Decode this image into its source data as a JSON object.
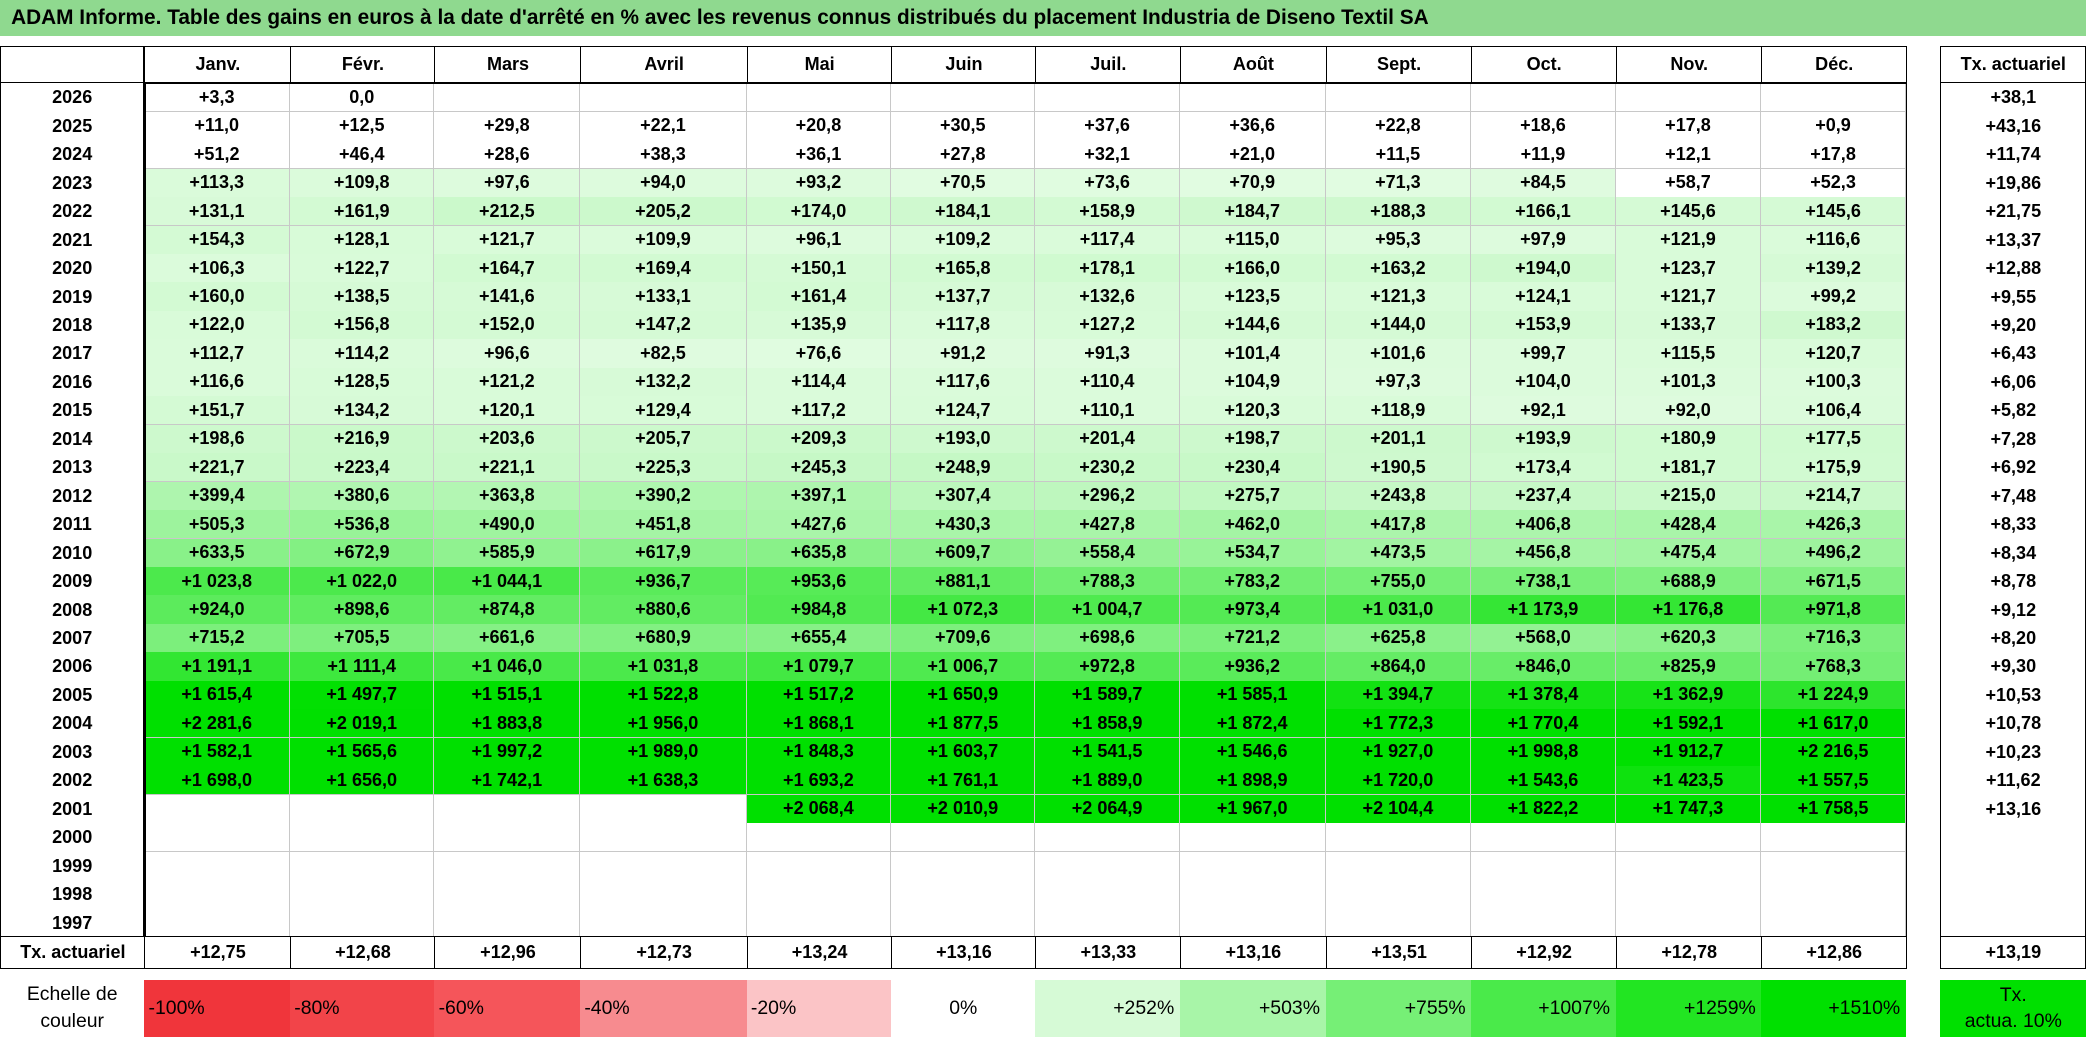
{
  "title": "ADAM Informe. Table des gains en euros à la date d'arrêté en % avec les revenus connus distribués du placement Industria de Diseno Textil SA",
  "months": [
    "Janv.",
    "Févr.",
    "Mars",
    "Avril",
    "Mai",
    "Juin",
    "Juil.",
    "Août",
    "Sept.",
    "Oct.",
    "Nov.",
    "Déc."
  ],
  "actuarial_header": "Tx. actuariel",
  "rows": [
    {
      "year": "2026",
      "values": [
        "+3,3",
        "0,0",
        "",
        "",
        "",
        "",
        "",
        "",
        "",
        "",
        "",
        ""
      ],
      "rate": "+38,1"
    },
    {
      "year": "2025",
      "values": [
        "+11,0",
        "+12,5",
        "+29,8",
        "+22,1",
        "+20,8",
        "+30,5",
        "+37,6",
        "+36,6",
        "+22,8",
        "+18,6",
        "+17,8",
        "+0,9"
      ],
      "rate": "+43,16"
    },
    {
      "year": "2024",
      "values": [
        "+51,2",
        "+46,4",
        "+28,6",
        "+38,3",
        "+36,1",
        "+27,8",
        "+32,1",
        "+21,0",
        "+11,5",
        "+11,9",
        "+12,1",
        "+17,8"
      ],
      "rate": "+11,74"
    },
    {
      "year": "2023",
      "values": [
        "+113,3",
        "+109,8",
        "+97,6",
        "+94,0",
        "+93,2",
        "+70,5",
        "+73,6",
        "+70,9",
        "+71,3",
        "+84,5",
        "+58,7",
        "+52,3"
      ],
      "rate": "+19,86"
    },
    {
      "year": "2022",
      "values": [
        "+131,1",
        "+161,9",
        "+212,5",
        "+205,2",
        "+174,0",
        "+184,1",
        "+158,9",
        "+184,7",
        "+188,3",
        "+166,1",
        "+145,6",
        "+145,6"
      ],
      "rate": "+21,75"
    },
    {
      "year": "2021",
      "values": [
        "+154,3",
        "+128,1",
        "+121,7",
        "+109,9",
        "+96,1",
        "+109,2",
        "+117,4",
        "+115,0",
        "+95,3",
        "+97,9",
        "+121,9",
        "+116,6"
      ],
      "rate": "+13,37"
    },
    {
      "year": "2020",
      "values": [
        "+106,3",
        "+122,7",
        "+164,7",
        "+169,4",
        "+150,1",
        "+165,8",
        "+178,1",
        "+166,0",
        "+163,2",
        "+194,0",
        "+123,7",
        "+139,2"
      ],
      "rate": "+12,88"
    },
    {
      "year": "2019",
      "values": [
        "+160,0",
        "+138,5",
        "+141,6",
        "+133,1",
        "+161,4",
        "+137,7",
        "+132,6",
        "+123,5",
        "+121,3",
        "+124,1",
        "+121,7",
        "+99,2"
      ],
      "rate": "+9,55"
    },
    {
      "year": "2018",
      "values": [
        "+122,0",
        "+156,8",
        "+152,0",
        "+147,2",
        "+135,9",
        "+117,8",
        "+127,2",
        "+144,6",
        "+144,0",
        "+153,9",
        "+133,7",
        "+183,2"
      ],
      "rate": "+9,20"
    },
    {
      "year": "2017",
      "values": [
        "+112,7",
        "+114,2",
        "+96,6",
        "+82,5",
        "+76,6",
        "+91,2",
        "+91,3",
        "+101,4",
        "+101,6",
        "+99,7",
        "+115,5",
        "+120,7"
      ],
      "rate": "+6,43"
    },
    {
      "year": "2016",
      "values": [
        "+116,6",
        "+128,5",
        "+121,2",
        "+132,2",
        "+114,4",
        "+117,6",
        "+110,4",
        "+104,9",
        "+97,3",
        "+104,0",
        "+101,3",
        "+100,3"
      ],
      "rate": "+6,06"
    },
    {
      "year": "2015",
      "values": [
        "+151,7",
        "+134,2",
        "+120,1",
        "+129,4",
        "+117,2",
        "+124,7",
        "+110,1",
        "+120,3",
        "+118,9",
        "+92,1",
        "+92,0",
        "+106,4"
      ],
      "rate": "+5,82"
    },
    {
      "year": "2014",
      "values": [
        "+198,6",
        "+216,9",
        "+203,6",
        "+205,7",
        "+209,3",
        "+193,0",
        "+201,4",
        "+198,7",
        "+201,1",
        "+193,9",
        "+180,9",
        "+177,5"
      ],
      "rate": "+7,28"
    },
    {
      "year": "2013",
      "values": [
        "+221,7",
        "+223,4",
        "+221,1",
        "+225,3",
        "+245,3",
        "+248,9",
        "+230,2",
        "+230,4",
        "+190,5",
        "+173,4",
        "+181,7",
        "+175,9"
      ],
      "rate": "+6,92"
    },
    {
      "year": "2012",
      "values": [
        "+399,4",
        "+380,6",
        "+363,8",
        "+390,2",
        "+397,1",
        "+307,4",
        "+296,2",
        "+275,7",
        "+243,8",
        "+237,4",
        "+215,0",
        "+214,7"
      ],
      "rate": "+7,48"
    },
    {
      "year": "2011",
      "values": [
        "+505,3",
        "+536,8",
        "+490,0",
        "+451,8",
        "+427,6",
        "+430,3",
        "+427,8",
        "+462,0",
        "+417,8",
        "+406,8",
        "+428,4",
        "+426,3"
      ],
      "rate": "+8,33"
    },
    {
      "year": "2010",
      "values": [
        "+633,5",
        "+672,9",
        "+585,9",
        "+617,9",
        "+635,8",
        "+609,7",
        "+558,4",
        "+534,7",
        "+473,5",
        "+456,8",
        "+475,4",
        "+496,2"
      ],
      "rate": "+8,34"
    },
    {
      "year": "2009",
      "values": [
        "+1 023,8",
        "+1 022,0",
        "+1 044,1",
        "+936,7",
        "+953,6",
        "+881,1",
        "+788,3",
        "+783,2",
        "+755,0",
        "+738,1",
        "+688,9",
        "+671,5"
      ],
      "rate": "+8,78"
    },
    {
      "year": "2008",
      "values": [
        "+924,0",
        "+898,6",
        "+874,8",
        "+880,6",
        "+984,8",
        "+1 072,3",
        "+1 004,7",
        "+973,4",
        "+1 031,0",
        "+1 173,9",
        "+1 176,8",
        "+971,8"
      ],
      "rate": "+9,12"
    },
    {
      "year": "2007",
      "values": [
        "+715,2",
        "+705,5",
        "+661,6",
        "+680,9",
        "+655,4",
        "+709,6",
        "+698,6",
        "+721,2",
        "+625,8",
        "+568,0",
        "+620,3",
        "+716,3"
      ],
      "rate": "+8,20"
    },
    {
      "year": "2006",
      "values": [
        "+1 191,1",
        "+1 111,4",
        "+1 046,0",
        "+1 031,8",
        "+1 079,7",
        "+1 006,7",
        "+972,8",
        "+936,2",
        "+864,0",
        "+846,0",
        "+825,9",
        "+768,3"
      ],
      "rate": "+9,30"
    },
    {
      "year": "2005",
      "values": [
        "+1 615,4",
        "+1 497,7",
        "+1 515,1",
        "+1 522,8",
        "+1 517,2",
        "+1 650,9",
        "+1 589,7",
        "+1 585,1",
        "+1 394,7",
        "+1 378,4",
        "+1 362,9",
        "+1 224,9"
      ],
      "rate": "+10,53"
    },
    {
      "year": "2004",
      "values": [
        "+2 281,6",
        "+2 019,1",
        "+1 883,8",
        "+1 956,0",
        "+1 868,1",
        "+1 877,5",
        "+1 858,9",
        "+1 872,4",
        "+1 772,3",
        "+1 770,4",
        "+1 592,1",
        "+1 617,0"
      ],
      "rate": "+10,78"
    },
    {
      "year": "2003",
      "values": [
        "+1 582,1",
        "+1 565,6",
        "+1 997,2",
        "+1 989,0",
        "+1 848,3",
        "+1 603,7",
        "+1 541,5",
        "+1 546,6",
        "+1 927,0",
        "+1 998,8",
        "+1 912,7",
        "+2 216,5"
      ],
      "rate": "+10,23"
    },
    {
      "year": "2002",
      "values": [
        "+1 698,0",
        "+1 656,0",
        "+1 742,1",
        "+1 638,3",
        "+1 693,2",
        "+1 761,1",
        "+1 889,0",
        "+1 898,9",
        "+1 720,0",
        "+1 543,6",
        "+1 423,5",
        "+1 557,5"
      ],
      "rate": "+11,62"
    },
    {
      "year": "2001",
      "values": [
        "",
        "",
        "",
        "",
        "+2 068,4",
        "+2 010,9",
        "+2 064,9",
        "+1 967,0",
        "+2 104,4",
        "+1 822,2",
        "+1 747,3",
        "+1 758,5"
      ],
      "rate": "+13,16"
    },
    {
      "year": "2000",
      "values": [
        "",
        "",
        "",
        "",
        "",
        "",
        "",
        "",
        "",
        "",
        "",
        ""
      ],
      "rate": ""
    },
    {
      "year": "1999",
      "values": [
        "",
        "",
        "",
        "",
        "",
        "",
        "",
        "",
        "",
        "",
        "",
        ""
      ],
      "rate": ""
    },
    {
      "year": "1998",
      "values": [
        "",
        "",
        "",
        "",
        "",
        "",
        "",
        "",
        "",
        "",
        "",
        ""
      ],
      "rate": ""
    },
    {
      "year": "1997",
      "values": [
        "",
        "",
        "",
        "",
        "",
        "",
        "",
        "",
        "",
        "",
        "",
        ""
      ],
      "rate": ""
    }
  ],
  "footer": {
    "label": "Tx. actuariel",
    "values": [
      "+12,75",
      "+12,68",
      "+12,96",
      "+12,73",
      "+13,24",
      "+13,16",
      "+13,33",
      "+13,16",
      "+13,51",
      "+12,92",
      "+12,78",
      "+12,86"
    ],
    "total": "+13,19"
  },
  "legend": {
    "label_line1": "Echelle de",
    "label_line2": "couleur",
    "items": [
      {
        "text": "-100%",
        "color": "#f0353b"
      },
      {
        "text": "-80%",
        "color": "#f24449"
      },
      {
        "text": "-60%",
        "color": "#f5555a"
      },
      {
        "text": "-40%",
        "color": "#f78b8f"
      },
      {
        "text": "-20%",
        "color": "#fbc4c6"
      },
      {
        "text": "0%",
        "color": "#ffffff"
      },
      {
        "text": "+252%",
        "color": "#d6fad6"
      },
      {
        "text": "+503%",
        "color": "#a8f5a8"
      },
      {
        "text": "+755%",
        "color": "#76ef76"
      },
      {
        "text": "+1007%",
        "color": "#4aea4a"
      },
      {
        "text": "+1259%",
        "color": "#22e522"
      },
      {
        "text": "+1510%",
        "color": "#00e000"
      }
    ],
    "actuarial_line1": "Tx.",
    "actuarial_line2": "actua. 10%",
    "actuarial_color": "#00e000"
  }
}
